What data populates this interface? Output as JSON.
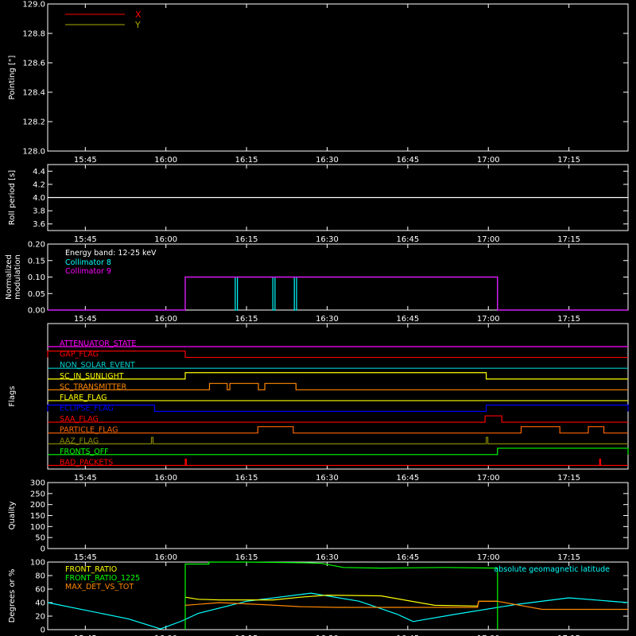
{
  "time_ticks": [
    "15:45",
    "16:00",
    "16:15",
    "16:30",
    "16:45",
    "17:00",
    "17:15"
  ],
  "time_tick_minutes": [
    945,
    960,
    975,
    990,
    1005,
    1020,
    1035
  ],
  "time_range_minutes": [
    938,
    1046
  ],
  "chart_data": [
    {
      "type": "line",
      "ylabel": "Pointing [\"]",
      "ylim": [
        128.0,
        129.0
      ],
      "yticks": [
        "128.0",
        "128.2",
        "128.4",
        "128.6",
        "128.8",
        "129.0"
      ],
      "ytick_values": [
        128.0,
        128.2,
        128.4,
        128.6,
        128.8,
        129.0
      ],
      "legend": [
        {
          "label": "X",
          "color": "#ff0000"
        },
        {
          "label": "Y",
          "color": "#aaaa00"
        }
      ],
      "series": [
        {
          "name": "X",
          "color": "#ff0000",
          "x": [],
          "y": []
        },
        {
          "name": "Y",
          "color": "#aaaa00",
          "x": [],
          "y": []
        }
      ]
    },
    {
      "type": "line",
      "ylabel": "Roll period [s]",
      "ylim": [
        3.5,
        4.5
      ],
      "yticks": [
        "3.6",
        "3.8",
        "4.0",
        "4.2",
        "4.4"
      ],
      "ytick_values": [
        3.6,
        3.8,
        4.0,
        4.2,
        4.4
      ],
      "series": [
        {
          "color": "#ffffff",
          "x": [
            938,
            1046
          ],
          "y": [
            4.0,
            4.0
          ]
        }
      ]
    },
    {
      "type": "line",
      "ylabel_lines": [
        "Normalized",
        "modulation"
      ],
      "ylim": [
        0.0,
        0.2
      ],
      "yticks": [
        "0.00",
        "0.05",
        "0.10",
        "0.15",
        "0.20"
      ],
      "ytick_values": [
        0.0,
        0.05,
        0.1,
        0.15,
        0.2
      ],
      "annotation": "Energy band: 12-25 keV",
      "legend": [
        {
          "label": "Collimator 8",
          "color": "#00ffff"
        },
        {
          "label": "Collimator 9",
          "color": "#ff00ff"
        }
      ],
      "series": [
        {
          "name": "Collimator 8",
          "color": "#00ffff",
          "x": [
            938,
            963.6,
            963.6,
            972.9,
            972.9,
            973.3,
            973.3,
            979.9,
            979.9,
            980.3,
            980.3,
            983.9,
            983.9,
            984.3,
            984.3,
            985.9,
            985.9,
            1021.7,
            1021.7,
            1046
          ],
          "y": [
            0,
            0,
            0.1,
            0.1,
            0,
            0,
            0.1,
            0.1,
            0,
            0,
            0.1,
            0.1,
            0,
            0,
            0.1,
            0.1,
            0.1,
            0.1,
            0,
            0
          ]
        },
        {
          "name": "Collimator 9",
          "color": "#ff00ff",
          "x": [
            938,
            963.6,
            963.6,
            1021.7,
            1021.7,
            1046
          ],
          "y": [
            0,
            0,
            0.1,
            0.1,
            0,
            0
          ]
        }
      ]
    },
    {
      "type": "line",
      "ylabel": "Flags",
      "flags": [
        {
          "label": "ATTENUATOR_STATE",
          "color": "#ff00ff",
          "segments": []
        },
        {
          "label": "GAP_FLAG",
          "color": "#ff0000",
          "segments": [
            [
              938,
              963.6
            ]
          ]
        },
        {
          "label": "NON_SOLAR_EVENT",
          "color": "#00cccc",
          "segments": []
        },
        {
          "label": "SC_IN_SUNLIGHT",
          "color": "#ffff00",
          "segments": [
            [
              963.6,
              1019.6
            ]
          ]
        },
        {
          "label": "SC_TRANSMITTER",
          "color": "#ff8800",
          "segments": [
            [
              968.1,
              971.4
            ],
            [
              971.9,
              977.2
            ],
            [
              978.4,
              984.2
            ]
          ]
        },
        {
          "label": "FLARE_FLAG",
          "color": "#ffff00",
          "segments": []
        },
        {
          "label": "ECLIPSE_FLAG",
          "color": "#0000ff",
          "segments": [
            [
              938,
              957.9
            ],
            [
              1019.6,
              1046
            ]
          ]
        },
        {
          "label": "SAA_FLAG",
          "color": "#ff0000",
          "segments": [
            [
              1019.4,
              1022.5
            ]
          ]
        },
        {
          "label": "PARTICLE_FLAG",
          "color": "#ff6600",
          "segments": [
            [
              977.1,
              983.7
            ],
            [
              1026.1,
              1033.3
            ],
            [
              1038.6,
              1041.5
            ]
          ]
        },
        {
          "label": "AAZ_FLAG",
          "color": "#888800",
          "segments": [
            [
              957.3,
              957.6
            ],
            [
              1019.6,
              1019.9
            ]
          ]
        },
        {
          "label": "FRONTS_OFF",
          "color": "#00ff00",
          "segments": [
            [
              1021.7,
              1046
            ]
          ]
        },
        {
          "label": "BAD_PACKETS",
          "color": "#ff0000",
          "segments": [
            [
              963.6,
              963.8
            ],
            [
              1040.7,
              1040.9
            ]
          ]
        }
      ]
    },
    {
      "type": "line",
      "ylabel": "Quality",
      "ylim": [
        0,
        300
      ],
      "yticks": [
        "0",
        "50",
        "100",
        "150",
        "200",
        "250",
        "300"
      ],
      "ytick_values": [
        0,
        50,
        100,
        150,
        200,
        250,
        300
      ],
      "series": []
    },
    {
      "type": "line",
      "ylabel": "Degrees or %",
      "ylim": [
        0,
        100
      ],
      "yticks": [
        "0",
        "20",
        "40",
        "60",
        "80",
        "100"
      ],
      "ytick_values": [
        0,
        20,
        40,
        60,
        80,
        100
      ],
      "annotation": "absolute geomagnetic latitude",
      "annotation_color": "#00ffff",
      "legend": [
        {
          "label": "FRONT_RATIO",
          "color": "#ffff00"
        },
        {
          "label": "FRONT_RATIO_1225",
          "color": "#00ff00"
        },
        {
          "label": "MAX_DET_VS_TOT",
          "color": "#ff8800"
        }
      ],
      "series": [
        {
          "name": "absolute geomagnetic latitude",
          "color": "#00ffff",
          "x": [
            938,
            953,
            959,
            963,
            966,
            975,
            987,
            996,
            1003,
            1006,
            1014,
            1025,
            1035,
            1046
          ],
          "y": [
            40,
            16,
            1,
            13,
            24,
            42,
            54,
            42,
            23,
            12,
            23,
            37,
            47,
            40
          ]
        },
        {
          "name": "FRONT_RATIO",
          "color": "#ffff00",
          "x": [
            963.6,
            966,
            970,
            975,
            980,
            985,
            990,
            1000,
            1010,
            1018,
            1018.2,
            1021.7
          ],
          "y": [
            48,
            45,
            44,
            44,
            44,
            48,
            51,
            50,
            36,
            35,
            42,
            42
          ]
        },
        {
          "name": "FRONT_RATIO_1225",
          "color": "#00ff00",
          "x": [
            963.6,
            963.6,
            968,
            968,
            975,
            986,
            989,
            993,
            1000,
            1012,
            1021.7,
            1021.7
          ],
          "y": [
            0,
            97,
            97,
            100,
            100,
            99,
            98,
            92,
            91,
            92,
            91,
            0
          ]
        },
        {
          "name": "MAX_DET_VS_TOT",
          "color": "#ff8800",
          "x": [
            963.6,
            970,
            978,
            985,
            992,
            1000,
            1010,
            1018,
            1018.2,
            1021.7,
            1030,
            1040,
            1046
          ],
          "y": [
            36,
            40,
            37,
            34,
            33,
            33,
            33,
            33,
            42,
            42,
            30,
            30,
            30
          ]
        }
      ]
    }
  ]
}
